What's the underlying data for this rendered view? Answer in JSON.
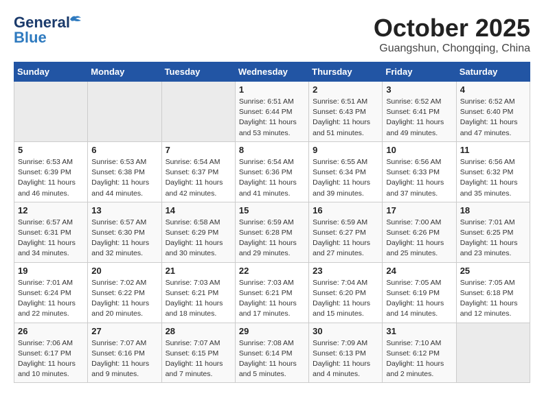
{
  "header": {
    "logo_line1": "General",
    "logo_line2": "Blue",
    "month": "October 2025",
    "location": "Guangshun, Chongqing, China"
  },
  "weekdays": [
    "Sunday",
    "Monday",
    "Tuesday",
    "Wednesday",
    "Thursday",
    "Friday",
    "Saturday"
  ],
  "weeks": [
    [
      {
        "day": "",
        "sunrise": "",
        "sunset": "",
        "daylight": ""
      },
      {
        "day": "",
        "sunrise": "",
        "sunset": "",
        "daylight": ""
      },
      {
        "day": "",
        "sunrise": "",
        "sunset": "",
        "daylight": ""
      },
      {
        "day": "1",
        "sunrise": "Sunrise: 6:51 AM",
        "sunset": "Sunset: 6:44 PM",
        "daylight": "Daylight: 11 hours and 53 minutes."
      },
      {
        "day": "2",
        "sunrise": "Sunrise: 6:51 AM",
        "sunset": "Sunset: 6:43 PM",
        "daylight": "Daylight: 11 hours and 51 minutes."
      },
      {
        "day": "3",
        "sunrise": "Sunrise: 6:52 AM",
        "sunset": "Sunset: 6:41 PM",
        "daylight": "Daylight: 11 hours and 49 minutes."
      },
      {
        "day": "4",
        "sunrise": "Sunrise: 6:52 AM",
        "sunset": "Sunset: 6:40 PM",
        "daylight": "Daylight: 11 hours and 47 minutes."
      }
    ],
    [
      {
        "day": "5",
        "sunrise": "Sunrise: 6:53 AM",
        "sunset": "Sunset: 6:39 PM",
        "daylight": "Daylight: 11 hours and 46 minutes."
      },
      {
        "day": "6",
        "sunrise": "Sunrise: 6:53 AM",
        "sunset": "Sunset: 6:38 PM",
        "daylight": "Daylight: 11 hours and 44 minutes."
      },
      {
        "day": "7",
        "sunrise": "Sunrise: 6:54 AM",
        "sunset": "Sunset: 6:37 PM",
        "daylight": "Daylight: 11 hours and 42 minutes."
      },
      {
        "day": "8",
        "sunrise": "Sunrise: 6:54 AM",
        "sunset": "Sunset: 6:36 PM",
        "daylight": "Daylight: 11 hours and 41 minutes."
      },
      {
        "day": "9",
        "sunrise": "Sunrise: 6:55 AM",
        "sunset": "Sunset: 6:34 PM",
        "daylight": "Daylight: 11 hours and 39 minutes."
      },
      {
        "day": "10",
        "sunrise": "Sunrise: 6:56 AM",
        "sunset": "Sunset: 6:33 PM",
        "daylight": "Daylight: 11 hours and 37 minutes."
      },
      {
        "day": "11",
        "sunrise": "Sunrise: 6:56 AM",
        "sunset": "Sunset: 6:32 PM",
        "daylight": "Daylight: 11 hours and 35 minutes."
      }
    ],
    [
      {
        "day": "12",
        "sunrise": "Sunrise: 6:57 AM",
        "sunset": "Sunset: 6:31 PM",
        "daylight": "Daylight: 11 hours and 34 minutes."
      },
      {
        "day": "13",
        "sunrise": "Sunrise: 6:57 AM",
        "sunset": "Sunset: 6:30 PM",
        "daylight": "Daylight: 11 hours and 32 minutes."
      },
      {
        "day": "14",
        "sunrise": "Sunrise: 6:58 AM",
        "sunset": "Sunset: 6:29 PM",
        "daylight": "Daylight: 11 hours and 30 minutes."
      },
      {
        "day": "15",
        "sunrise": "Sunrise: 6:59 AM",
        "sunset": "Sunset: 6:28 PM",
        "daylight": "Daylight: 11 hours and 29 minutes."
      },
      {
        "day": "16",
        "sunrise": "Sunrise: 6:59 AM",
        "sunset": "Sunset: 6:27 PM",
        "daylight": "Daylight: 11 hours and 27 minutes."
      },
      {
        "day": "17",
        "sunrise": "Sunrise: 7:00 AM",
        "sunset": "Sunset: 6:26 PM",
        "daylight": "Daylight: 11 hours and 25 minutes."
      },
      {
        "day": "18",
        "sunrise": "Sunrise: 7:01 AM",
        "sunset": "Sunset: 6:25 PM",
        "daylight": "Daylight: 11 hours and 23 minutes."
      }
    ],
    [
      {
        "day": "19",
        "sunrise": "Sunrise: 7:01 AM",
        "sunset": "Sunset: 6:24 PM",
        "daylight": "Daylight: 11 hours and 22 minutes."
      },
      {
        "day": "20",
        "sunrise": "Sunrise: 7:02 AM",
        "sunset": "Sunset: 6:22 PM",
        "daylight": "Daylight: 11 hours and 20 minutes."
      },
      {
        "day": "21",
        "sunrise": "Sunrise: 7:03 AM",
        "sunset": "Sunset: 6:21 PM",
        "daylight": "Daylight: 11 hours and 18 minutes."
      },
      {
        "day": "22",
        "sunrise": "Sunrise: 7:03 AM",
        "sunset": "Sunset: 6:21 PM",
        "daylight": "Daylight: 11 hours and 17 minutes."
      },
      {
        "day": "23",
        "sunrise": "Sunrise: 7:04 AM",
        "sunset": "Sunset: 6:20 PM",
        "daylight": "Daylight: 11 hours and 15 minutes."
      },
      {
        "day": "24",
        "sunrise": "Sunrise: 7:05 AM",
        "sunset": "Sunset: 6:19 PM",
        "daylight": "Daylight: 11 hours and 14 minutes."
      },
      {
        "day": "25",
        "sunrise": "Sunrise: 7:05 AM",
        "sunset": "Sunset: 6:18 PM",
        "daylight": "Daylight: 11 hours and 12 minutes."
      }
    ],
    [
      {
        "day": "26",
        "sunrise": "Sunrise: 7:06 AM",
        "sunset": "Sunset: 6:17 PM",
        "daylight": "Daylight: 11 hours and 10 minutes."
      },
      {
        "day": "27",
        "sunrise": "Sunrise: 7:07 AM",
        "sunset": "Sunset: 6:16 PM",
        "daylight": "Daylight: 11 hours and 9 minutes."
      },
      {
        "day": "28",
        "sunrise": "Sunrise: 7:07 AM",
        "sunset": "Sunset: 6:15 PM",
        "daylight": "Daylight: 11 hours and 7 minutes."
      },
      {
        "day": "29",
        "sunrise": "Sunrise: 7:08 AM",
        "sunset": "Sunset: 6:14 PM",
        "daylight": "Daylight: 11 hours and 5 minutes."
      },
      {
        "day": "30",
        "sunrise": "Sunrise: 7:09 AM",
        "sunset": "Sunset: 6:13 PM",
        "daylight": "Daylight: 11 hours and 4 minutes."
      },
      {
        "day": "31",
        "sunrise": "Sunrise: 7:10 AM",
        "sunset": "Sunset: 6:12 PM",
        "daylight": "Daylight: 11 hours and 2 minutes."
      },
      {
        "day": "",
        "sunrise": "",
        "sunset": "",
        "daylight": ""
      }
    ]
  ]
}
